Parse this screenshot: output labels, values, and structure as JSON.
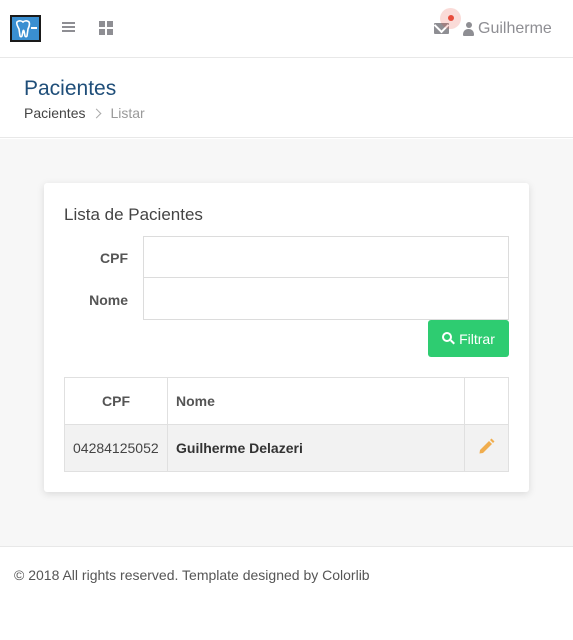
{
  "nav": {
    "user_name": "Guilherme"
  },
  "header": {
    "title": "Pacientes",
    "breadcrumb": [
      "Pacientes",
      "Listar"
    ]
  },
  "card": {
    "title": "Lista de Pacientes",
    "form": {
      "cpf_label": "CPF",
      "cpf_value": "",
      "nome_label": "Nome",
      "nome_value": "",
      "filter_button": "Filtrar"
    },
    "table": {
      "headers": [
        "CPF",
        "Nome",
        ""
      ],
      "rows": [
        {
          "cpf": "04284125052",
          "nome": "Guilherme Delazeri"
        }
      ]
    }
  },
  "footer": {
    "text": "© 2018 All rights reserved. Template designed by Colorlib"
  },
  "colors": {
    "accent_green": "#2ecc71",
    "edit_icon": "#f0ad4e",
    "title_blue": "#1f4e79",
    "logo_blue": "#3a8fd1",
    "notification": "#e74c3c"
  },
  "icons": {
    "logo": "tooth-icon",
    "menu": "bars-icon",
    "apps": "grid-icon",
    "mail": "envelope-icon",
    "user": "user-icon",
    "filter": "search-icon",
    "edit": "pencil-icon"
  }
}
